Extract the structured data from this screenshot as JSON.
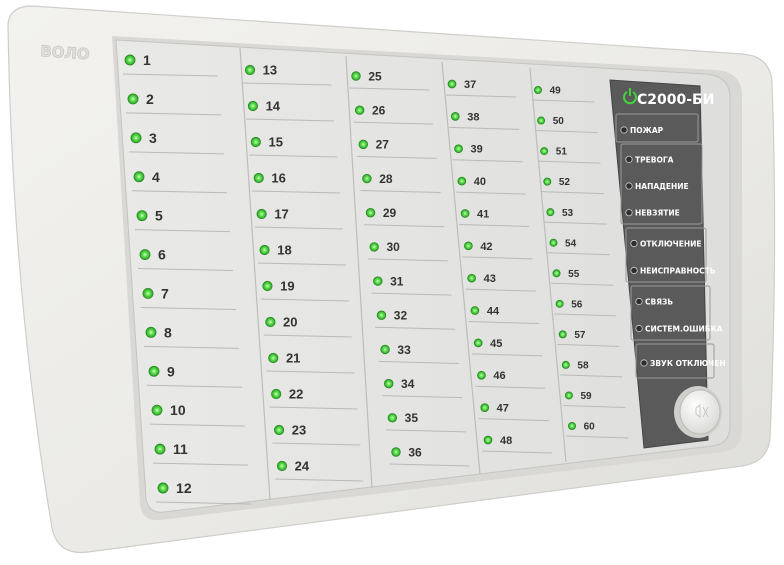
{
  "device": {
    "brand": "ВОЛО",
    "model": "С2000-БИ",
    "colors": {
      "housing": "#ecebe7",
      "panel": "#e3e3e0",
      "status_panel": "#5a5a5a",
      "led_on": "#3fd43a",
      "led_off": "#2e2e2e"
    }
  },
  "indicators": [
    "1",
    "2",
    "3",
    "4",
    "5",
    "6",
    "7",
    "8",
    "9",
    "10",
    "11",
    "12",
    "13",
    "14",
    "15",
    "16",
    "17",
    "18",
    "19",
    "20",
    "21",
    "22",
    "23",
    "24",
    "25",
    "26",
    "27",
    "28",
    "29",
    "30",
    "31",
    "32",
    "33",
    "34",
    "35",
    "36",
    "37",
    "38",
    "39",
    "40",
    "41",
    "42",
    "43",
    "44",
    "45",
    "46",
    "47",
    "48",
    "49",
    "50",
    "51",
    "52",
    "53",
    "54",
    "55",
    "56",
    "57",
    "58",
    "59",
    "60"
  ],
  "status_groups": [
    [
      "ПОЖАР"
    ],
    [
      "ТРЕВОГА",
      "НАПАДЕНИЕ",
      "НЕВЗЯТИЕ"
    ],
    [
      "ОТКЛЮЧЕНИЕ",
      "НЕИСПРАВНОСТЬ"
    ],
    [
      "СВЯЗЬ",
      "СИСТЕМ.ОШИБКА"
    ],
    [
      "ЗВУК ОТКЛЮЧЕН"
    ]
  ],
  "button": {
    "icon": "sound-off-icon"
  }
}
